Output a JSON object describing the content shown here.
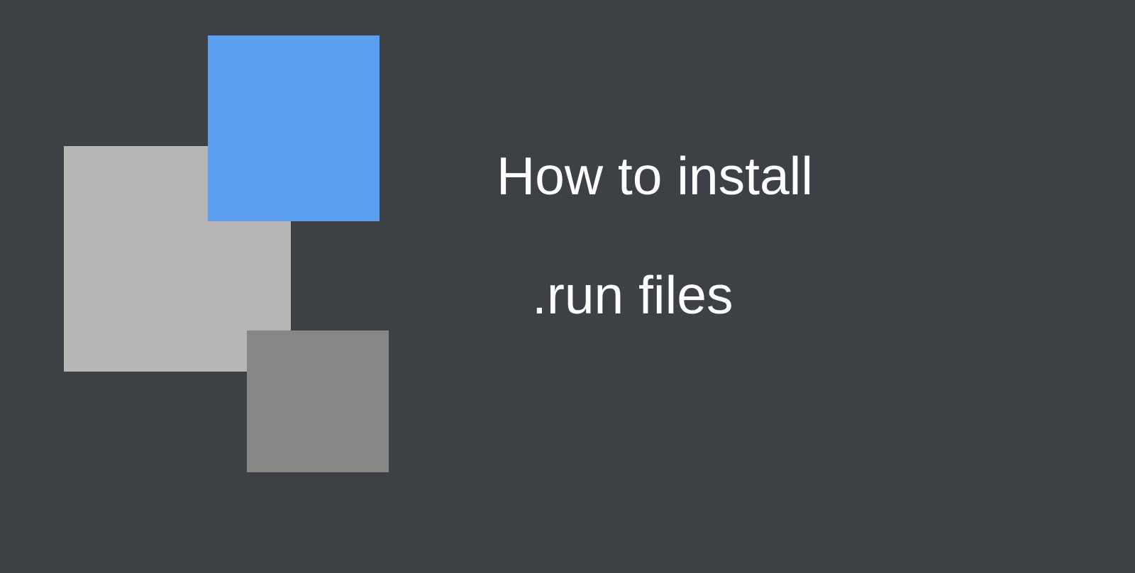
{
  "title": {
    "line1": "How to install",
    "line2": ".run files"
  },
  "colors": {
    "background": "#3d4045",
    "square_light": "#b6b6b6",
    "square_blue": "#5c9ef0",
    "square_dark": "#878787",
    "text": "#ffffff"
  }
}
